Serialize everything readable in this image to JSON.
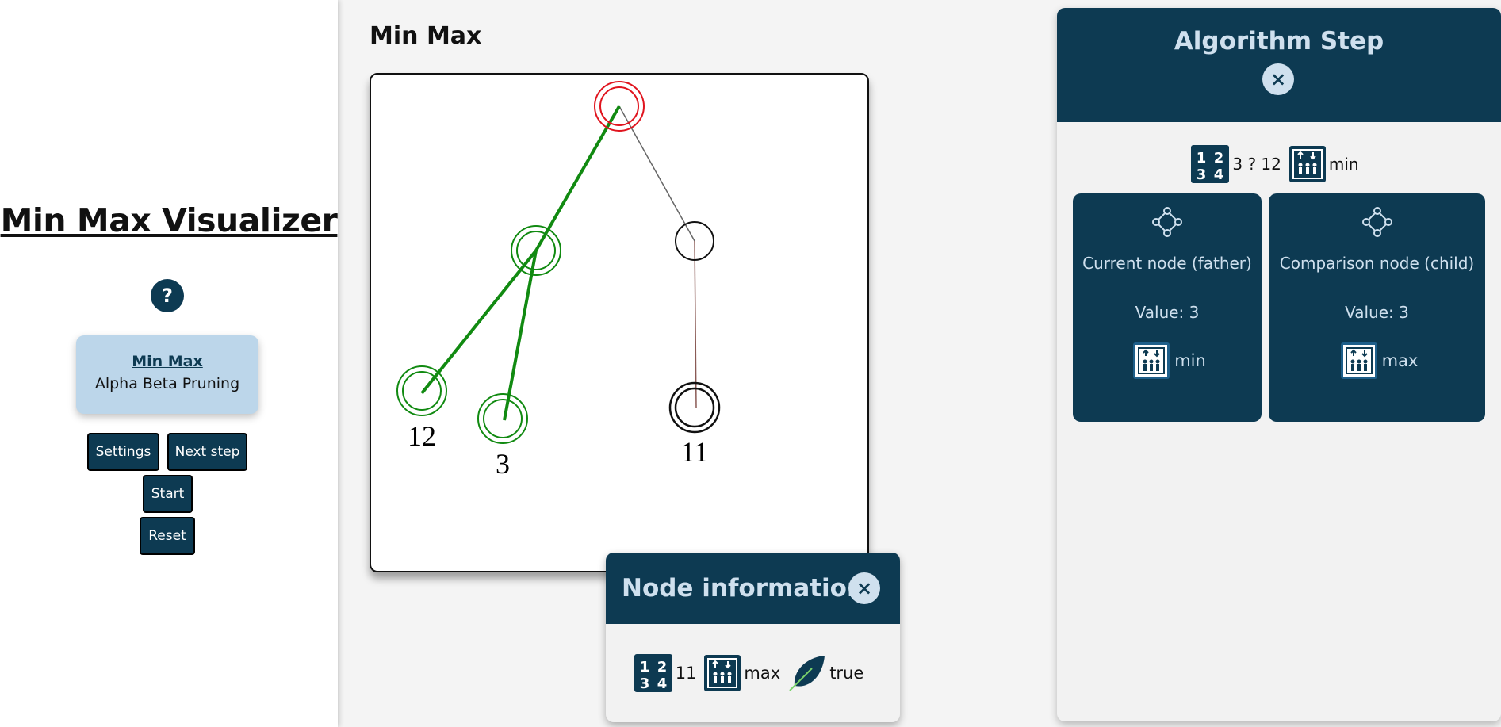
{
  "sidebar": {
    "title": "Min Max Visualizer",
    "help": "?",
    "algorithms": {
      "selected": "Min Max",
      "other": "Alpha Beta Pruning"
    },
    "buttons": {
      "settings": "Settings",
      "next_step": "Next step",
      "start": "Start",
      "reset": "Reset"
    }
  },
  "main": {
    "title": "Min Max",
    "leaf_values": [
      "12",
      "3",
      "11"
    ]
  },
  "node_info": {
    "title": "Node information",
    "close": "×",
    "value": "11",
    "type": "max",
    "leaf": "true",
    "icons": [
      "numbers-icon",
      "elevator-icon",
      "leaf-icon"
    ]
  },
  "algorithm_step": {
    "title": "Algorithm Step",
    "close": "×",
    "comparison": "3 ? 12",
    "comparison_type": "min",
    "current": {
      "label": "Current node (father)",
      "value": "Value: 3",
      "type": "min"
    },
    "child": {
      "label": "Comparison node (child)",
      "value": "Value: 3",
      "type": "max"
    }
  },
  "colors": {
    "primary": "#0d3a52",
    "accent_light": "#cfe0ee",
    "card_bg": "#bcd6ea",
    "path_green": "#118a11",
    "root_red": "#e0141e"
  }
}
